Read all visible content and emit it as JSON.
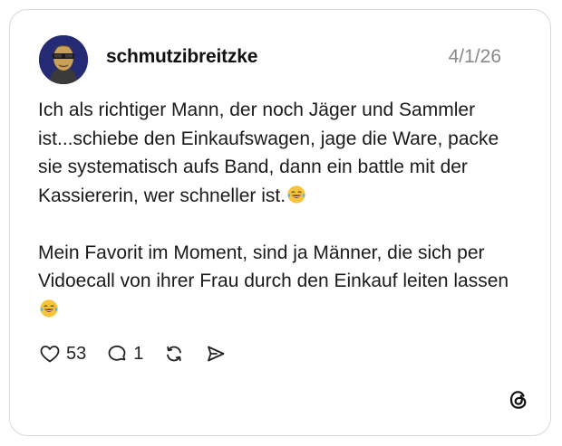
{
  "post": {
    "username": "schmutzibreitzke",
    "date": "4/1/26",
    "text_paragraph_1": "Ich als richtiger Mann, der noch Jäger und Sammler ist...schiebe den Einkaufswagen, jage die Ware, packe sie systematisch aufs Band, dann ein battle mit der Kassiererin, wer schneller ist.",
    "text_paragraph_2": "Mein Favorit im Moment, sind ja Männer, die sich per Vidoecall von ihrer Frau durch den Einkauf leiten lassen",
    "emoji_icon": "tears-of-joy-emoji"
  },
  "actions": {
    "like_count": "53",
    "reply_count": "1",
    "like_icon": "heart-icon",
    "reply_icon": "speech-bubble-icon",
    "repost_icon": "repost-icon",
    "share_icon": "send-icon"
  },
  "branding": {
    "logo_icon": "threads-logo-icon"
  }
}
